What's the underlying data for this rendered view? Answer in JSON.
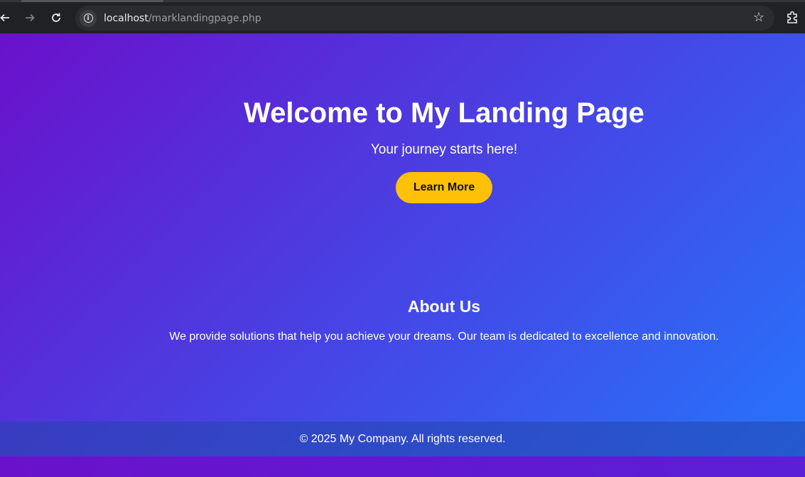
{
  "browser": {
    "url_host": "localhost",
    "url_path": "/marklandingpage.php",
    "back_icon": "arrow-left-icon",
    "forward_icon": "arrow-right-icon",
    "reload_icon": "reload-icon",
    "star_icon": "star-icon",
    "extensions_icon": "puzzle-icon"
  },
  "hero": {
    "title": "Welcome to My Landing Page",
    "subtitle": "Your journey starts here!",
    "button_label": "Learn More"
  },
  "about": {
    "heading": "About Us",
    "text": "We provide solutions that help you achieve your dreams. Our team is dedicated to excellence and innovation."
  },
  "footer": {
    "text": "© 2025 My Company. All rights reserved."
  },
  "colors": {
    "gradient_start": "#6a11cb",
    "gradient_end": "#2575fc",
    "button": "#ffc107"
  }
}
